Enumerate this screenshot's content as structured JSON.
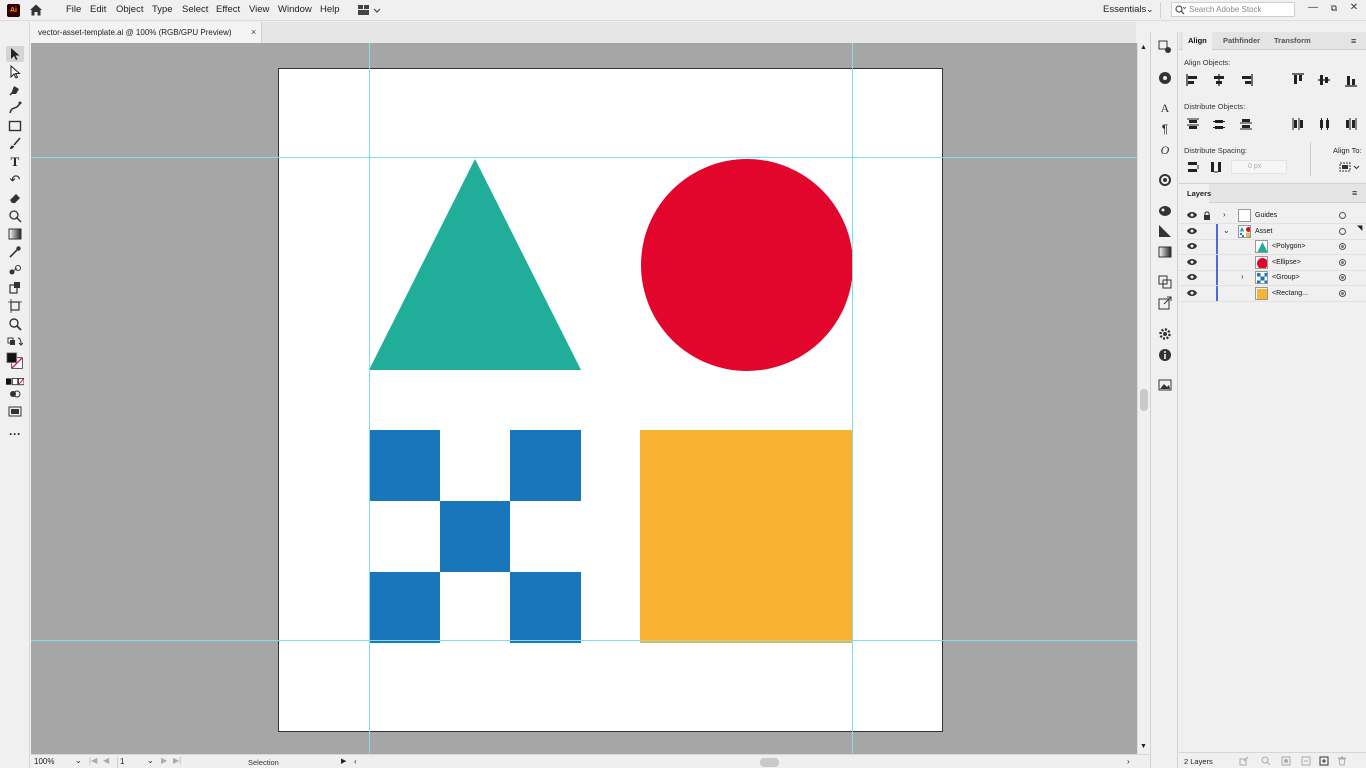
{
  "app": {
    "logo_text": "Ai"
  },
  "menu": [
    "File",
    "Edit",
    "Object",
    "Type",
    "Select",
    "Effect",
    "View",
    "Window",
    "Help"
  ],
  "workspace": {
    "label": "Essentials"
  },
  "stock_search": {
    "placeholder": "Search Adobe Stock"
  },
  "document_tab": {
    "label": "vector-asset-template.ai @ 100% (RGB/GPU Preview)",
    "close": "×"
  },
  "colors": {
    "triangle": "#20ae9a",
    "circle": "#e2062c",
    "checker": "#1a76bb",
    "rectangle": "#f8b333",
    "guide": "#7ee0ea",
    "canvas_bg": "#a6a6a6"
  },
  "align_panel": {
    "tabs": [
      "Align",
      "Pathfinder",
      "Transform"
    ],
    "align_objects_label": "Align Objects:",
    "distribute_objects_label": "Distribute Objects:",
    "distribute_spacing_label": "Distribute Spacing:",
    "spacing_value": "0 px",
    "align_to_label": "Align To:"
  },
  "layers_panel": {
    "title": "Layers",
    "rows": [
      {
        "name": "Guides",
        "thumb": "blank",
        "locked": true
      },
      {
        "name": "Asset",
        "thumb": "asset",
        "expanded": true
      },
      {
        "name": "<Polygon>",
        "thumb": "triangle"
      },
      {
        "name": "<Ellipse>",
        "thumb": "circle"
      },
      {
        "name": "<Group>",
        "thumb": "checker"
      },
      {
        "name": "<Rectang...",
        "thumb": "rect"
      }
    ],
    "footer_count": "2 Layers"
  },
  "status": {
    "zoom": "100%",
    "page": "1",
    "tool": "Selection"
  }
}
